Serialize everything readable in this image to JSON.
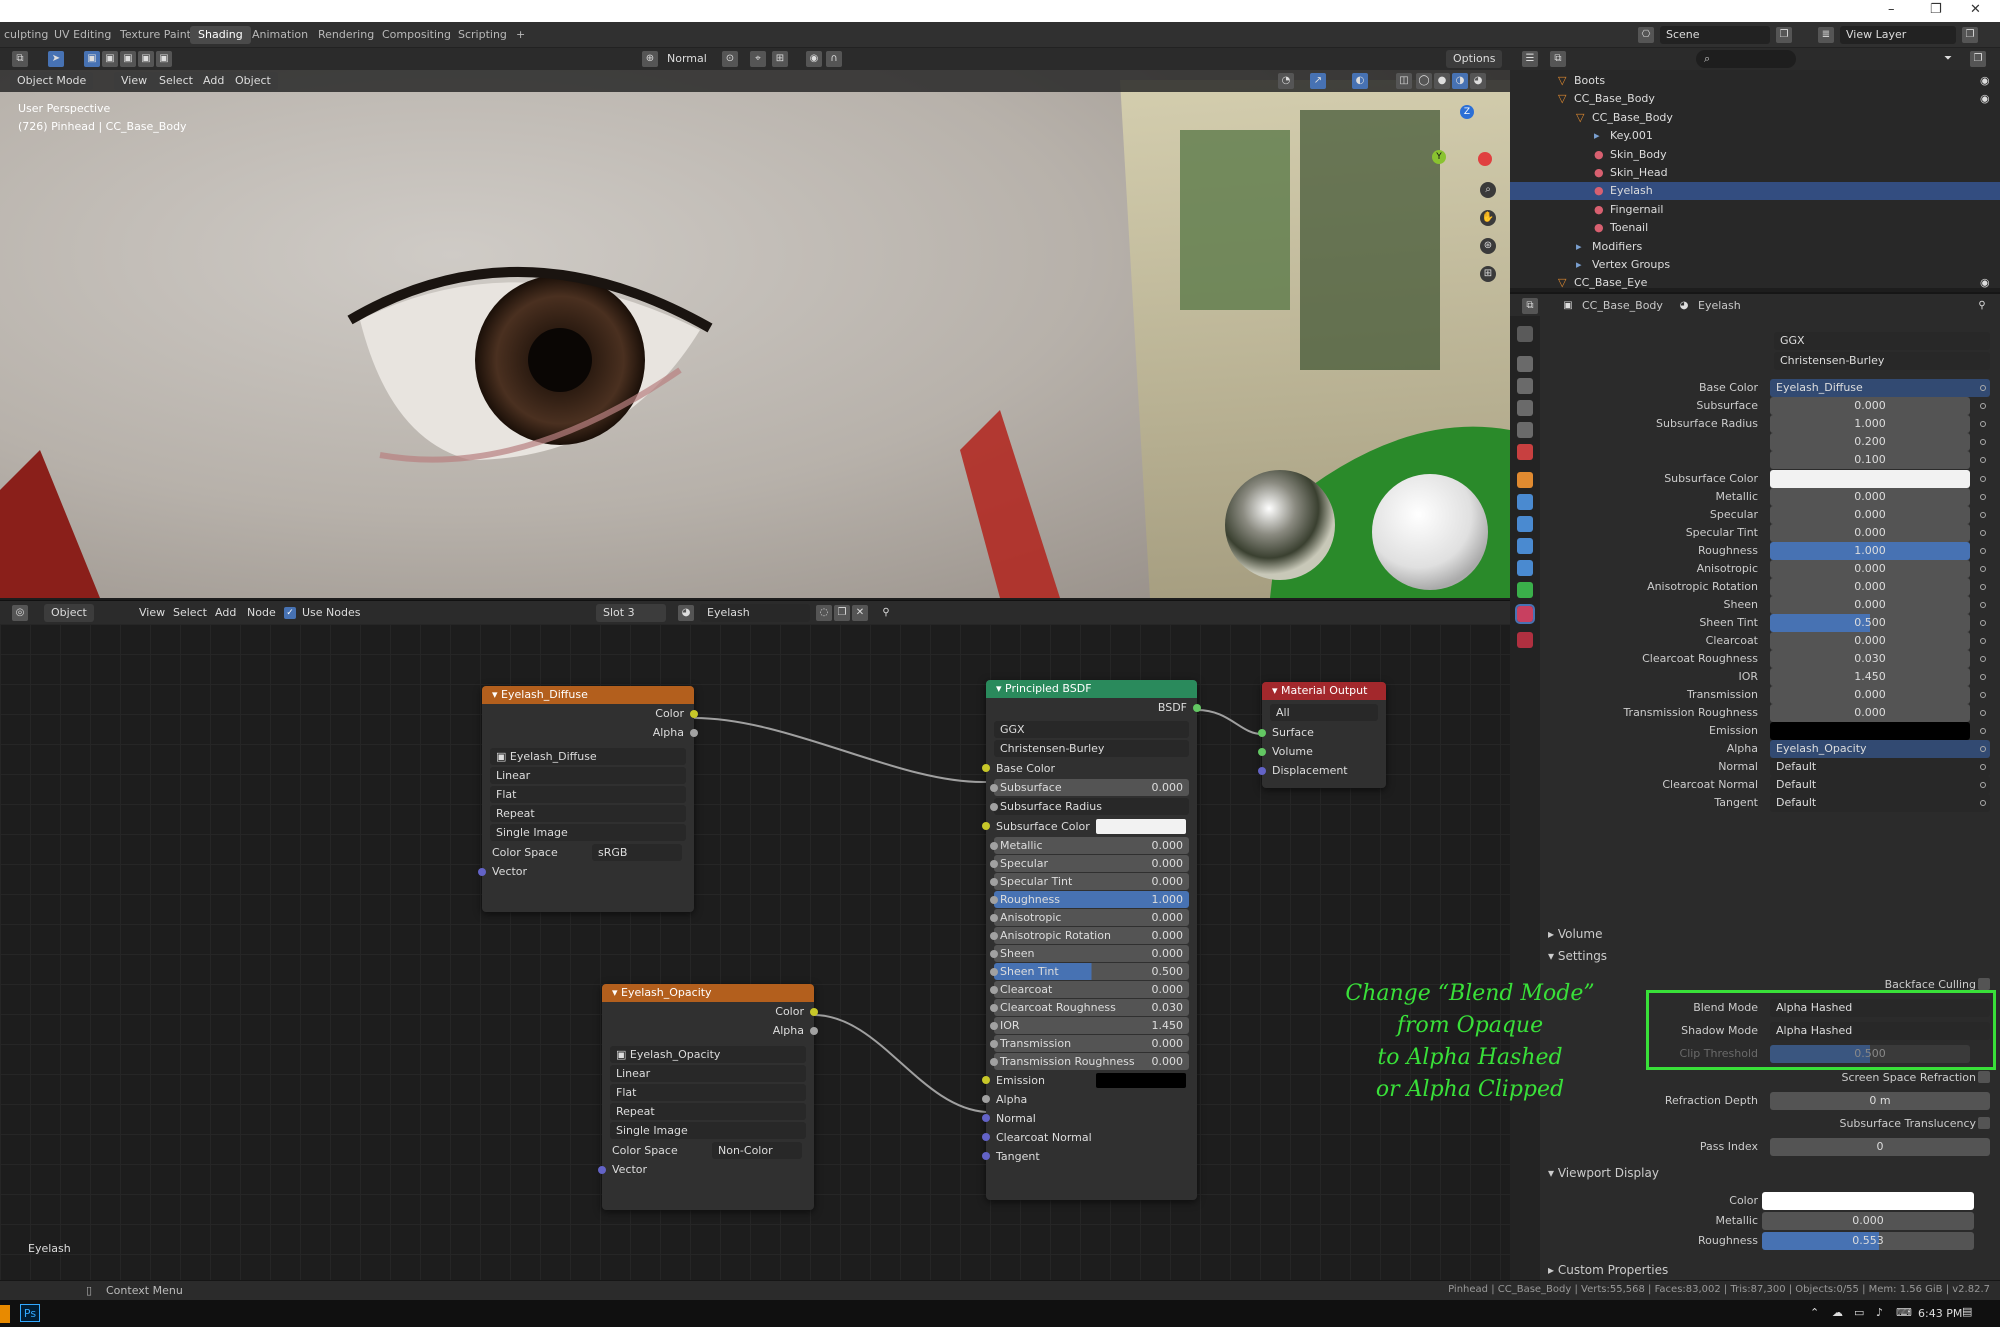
{
  "workspace_tabs": [
    "culpting",
    "UV Editing",
    "Texture Paint",
    "Shading",
    "Animation",
    "Rendering",
    "Compositing",
    "Scripting",
    "+"
  ],
  "active_tab": "Shading",
  "scene": "Scene",
  "view_layer": "View Layer",
  "viewport": {
    "shading_mode": "Normal",
    "options_label": "Options",
    "mode": "Object Mode",
    "menu": [
      "View",
      "Select",
      "Add",
      "Object"
    ],
    "overlay_line1": "User Perspective",
    "overlay_line2": "(726) Pinhead | CC_Base_Body",
    "gizmo_z": "Z",
    "gizmo_y": "Y"
  },
  "node_editor": {
    "object_dropdown": "Object",
    "menu": [
      "View",
      "Select",
      "Add",
      "Node"
    ],
    "use_nodes": "Use Nodes",
    "slot": "Slot 3",
    "material": "Eyelash",
    "footer_label": "Eyelash"
  },
  "node_diffuse": {
    "title": "Eyelash_Diffuse",
    "out_color": "Color",
    "out_alpha": "Alpha",
    "image": "Eyelash_Diffuse",
    "interpolation": "Linear",
    "projection": "Flat",
    "extension": "Repeat",
    "source": "Single Image",
    "color_space_label": "Color Space",
    "color_space": "sRGB",
    "in_vector": "Vector"
  },
  "node_opacity": {
    "title": "Eyelash_Opacity",
    "out_color": "Color",
    "out_alpha": "Alpha",
    "image": "Eyelash_Opacity",
    "interpolation": "Linear",
    "projection": "Flat",
    "extension": "Repeat",
    "source": "Single Image",
    "color_space_label": "Color Space",
    "color_space": "Non-Color",
    "in_vector": "Vector"
  },
  "node_bsdf": {
    "title": "Principled BSDF",
    "out": "BSDF",
    "distribution": "GGX",
    "subsurface_method": "Christensen-Burley",
    "rows": [
      {
        "label": "Base Color",
        "value": "",
        "type": "plain"
      },
      {
        "label": "Subsurface",
        "value": "0.000",
        "type": "field"
      },
      {
        "label": "Subsurface Radius",
        "value": "",
        "type": "drop"
      },
      {
        "label": "Subsurface Color",
        "value": "",
        "type": "white"
      },
      {
        "label": "Metallic",
        "value": "0.000",
        "type": "field"
      },
      {
        "label": "Specular",
        "value": "0.000",
        "type": "field"
      },
      {
        "label": "Specular Tint",
        "value": "0.000",
        "type": "field"
      },
      {
        "label": "Roughness",
        "value": "1.000",
        "type": "blue"
      },
      {
        "label": "Anisotropic",
        "value": "0.000",
        "type": "field"
      },
      {
        "label": "Anisotropic Rotation",
        "value": "0.000",
        "type": "field"
      },
      {
        "label": "Sheen",
        "value": "0.000",
        "type": "field"
      },
      {
        "label": "Sheen Tint",
        "value": "0.500",
        "type": "half"
      },
      {
        "label": "Clearcoat",
        "value": "0.000",
        "type": "field"
      },
      {
        "label": "Clearcoat Roughness",
        "value": "0.030",
        "type": "field"
      },
      {
        "label": "IOR",
        "value": "1.450",
        "type": "field"
      },
      {
        "label": "Transmission",
        "value": "0.000",
        "type": "field"
      },
      {
        "label": "Transmission Roughness",
        "value": "0.000",
        "type": "field"
      },
      {
        "label": "Emission",
        "value": "",
        "type": "black"
      },
      {
        "label": "Alpha",
        "value": "",
        "type": "plain"
      },
      {
        "label": "Normal",
        "value": "",
        "type": "plain"
      },
      {
        "label": "Clearcoat Normal",
        "value": "",
        "type": "plain"
      },
      {
        "label": "Tangent",
        "value": "",
        "type": "plain"
      }
    ]
  },
  "node_output": {
    "title": "Material Output",
    "target": "All",
    "inputs": [
      "Surface",
      "Volume",
      "Displacement"
    ]
  },
  "outliner": {
    "rows": [
      {
        "label": "Boots",
        "indent": 0,
        "icon": "▽"
      },
      {
        "label": "CC_Base_Body",
        "indent": 0,
        "icon": "▽"
      },
      {
        "label": "CC_Base_Body",
        "indent": 1,
        "icon": "▽"
      },
      {
        "label": "Key.001",
        "indent": 2,
        "icon": "▸"
      },
      {
        "label": "Skin_Body",
        "indent": 2,
        "icon": "●"
      },
      {
        "label": "Skin_Head",
        "indent": 2,
        "icon": "●"
      },
      {
        "label": "Eyelash",
        "indent": 2,
        "icon": "●",
        "selected": true
      },
      {
        "label": "Fingernail",
        "indent": 2,
        "icon": "●"
      },
      {
        "label": "Toenail",
        "indent": 2,
        "icon": "●"
      },
      {
        "label": "Modifiers",
        "indent": 1,
        "icon": "▸"
      },
      {
        "label": "Vertex Groups",
        "indent": 1,
        "icon": "▸"
      },
      {
        "label": "CC_Base_Eye",
        "indent": 0,
        "icon": "▽"
      }
    ]
  },
  "props": {
    "breadcrumb_object": "CC_Base_Body",
    "breadcrumb_material": "Eyelash",
    "distribution": "GGX",
    "subsurface_method": "Christensen-Burley",
    "rows": [
      {
        "label": "Base Color",
        "value": "Eyelash_Diffuse",
        "type": "link"
      },
      {
        "label": "Subsurface",
        "value": "0.000",
        "type": "field"
      },
      {
        "label": "Subsurface Radius",
        "value": "1.000",
        "type": "field"
      },
      {
        "label": "",
        "value": "0.200",
        "type": "field"
      },
      {
        "label": "",
        "value": "0.100",
        "type": "field"
      },
      {
        "label": "Subsurface Color",
        "value": "",
        "type": "white"
      },
      {
        "label": "Metallic",
        "value": "0.000",
        "type": "field"
      },
      {
        "label": "Specular",
        "value": "0.000",
        "type": "field"
      },
      {
        "label": "Specular Tint",
        "value": "0.000",
        "type": "field"
      },
      {
        "label": "Roughness",
        "value": "1.000",
        "type": "blue"
      },
      {
        "label": "Anisotropic",
        "value": "0.000",
        "type": "field"
      },
      {
        "label": "Anisotropic Rotation",
        "value": "0.000",
        "type": "field"
      },
      {
        "label": "Sheen",
        "value": "0.000",
        "type": "field"
      },
      {
        "label": "Sheen Tint",
        "value": "0.500",
        "type": "half"
      },
      {
        "label": "Clearcoat",
        "value": "0.000",
        "type": "field"
      },
      {
        "label": "Clearcoat Roughness",
        "value": "0.030",
        "type": "field"
      },
      {
        "label": "IOR",
        "value": "1.450",
        "type": "field"
      },
      {
        "label": "Transmission",
        "value": "0.000",
        "type": "field"
      },
      {
        "label": "Transmission Roughness",
        "value": "0.000",
        "type": "field"
      },
      {
        "label": "Emission",
        "value": "",
        "type": "black"
      },
      {
        "label": "Alpha",
        "value": "Eyelash_Opacity",
        "type": "link"
      },
      {
        "label": "Normal",
        "value": "Default",
        "type": "text"
      },
      {
        "label": "Clearcoat Normal",
        "value": "Default",
        "type": "text"
      },
      {
        "label": "Tangent",
        "value": "Default",
        "type": "text"
      }
    ],
    "volume_section": "Volume",
    "settings_section": "Settings",
    "backface_culling": "Backface Culling",
    "blend_mode_label": "Blend Mode",
    "blend_mode": "Alpha Hashed",
    "shadow_mode_label": "Shadow Mode",
    "shadow_mode": "Alpha Hashed",
    "clip_threshold_label": "Clip Threshold",
    "clip_threshold": "0.500",
    "screen_space_refraction": "Screen Space Refraction",
    "refraction_depth_label": "Refraction Depth",
    "refraction_depth": "0 m",
    "subsurface_translucency": "Subsurface Translucency",
    "pass_index_label": "Pass Index",
    "pass_index": "0",
    "viewport_display_section": "Viewport Display",
    "vd_color_label": "Color",
    "vd_metallic_label": "Metallic",
    "vd_metallic": "0.000",
    "vd_roughness_label": "Roughness",
    "vd_roughness": "0.553",
    "custom_properties_section": "Custom Properties"
  },
  "annotation": {
    "line1": "Change “Blend Mode”",
    "line2": "from Opaque",
    "line3": "to Alpha Hashed",
    "line4": "or Alpha Clipped",
    "color": "#39e039"
  },
  "status": {
    "context_menu": "Context Menu",
    "stats": "Pinhead | CC_Base_Body | Verts:55,568 | Faces:83,002 | Tris:87,300 | Objects:0/55 | Mem: 1.56 GiB | v2.82.7"
  },
  "taskbar": {
    "time": "6:43 PM",
    "ps_label": "Ps"
  },
  "colors": {
    "accent_blue": "#4772b3",
    "selection": "#334d80",
    "node_image_header": "#b35f1d",
    "node_bsdf_header": "#2a8a5c",
    "node_output_header": "#a3282c"
  }
}
